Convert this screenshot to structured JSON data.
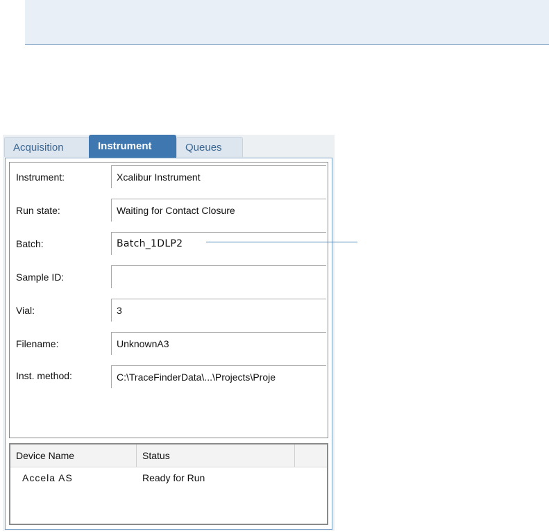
{
  "tabs": [
    {
      "label": "Acquisition"
    },
    {
      "label": "Instrument"
    },
    {
      "label": "Queues"
    }
  ],
  "fields": {
    "instrument": {
      "label": "Instrument:",
      "value": "Xcalibur Instrument"
    },
    "run_state": {
      "label": "Run state:",
      "value": "Waiting for Contact Closure"
    },
    "batch": {
      "label": "Batch:",
      "value": "Batch_1DLP2"
    },
    "sample_id": {
      "label": "Sample ID:",
      "value": ""
    },
    "vial": {
      "label": "Vial:",
      "value": "3"
    },
    "filename": {
      "label": "Filename:",
      "value": "UnknownA3"
    },
    "inst_method": {
      "label": "Inst. method:",
      "value": "C:\\TraceFinderData\\...\\Projects\\Proje"
    }
  },
  "device_table": {
    "columns": [
      "Device Name",
      "Status"
    ],
    "rows": [
      {
        "device": "Accela AS",
        "status": "Ready for Run"
      }
    ]
  }
}
